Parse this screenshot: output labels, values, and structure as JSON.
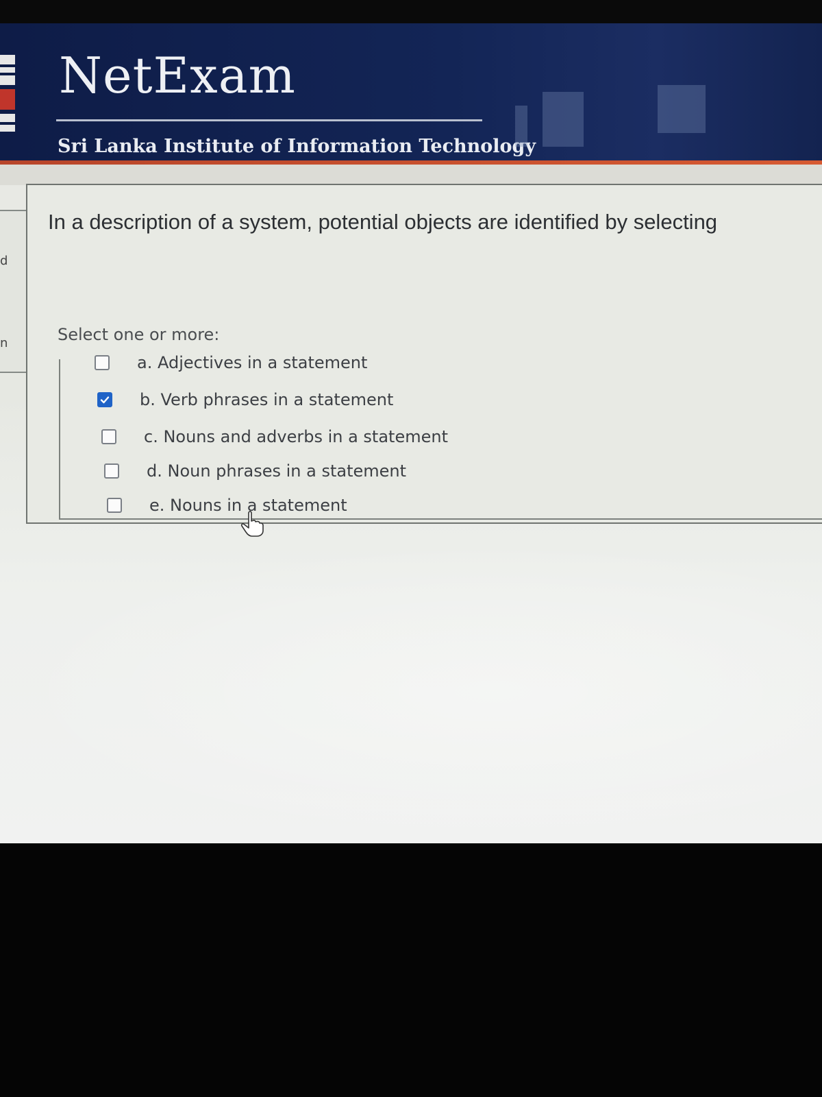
{
  "header": {
    "brand": "NetExam",
    "institution": "Sri Lanka Institute of Information Technology"
  },
  "sidebar_fragments": [
    "d",
    "n"
  ],
  "question": {
    "text": "In a description of a system,  potential objects are identified by selecting",
    "prompt": "Select one or more:",
    "options": [
      {
        "label": "a. Adjectives in a statement",
        "checked": false
      },
      {
        "label": "b. Verb phrases in a statement",
        "checked": true
      },
      {
        "label": "c. Nouns and adverbs in a statement",
        "checked": false
      },
      {
        "label": "d. Noun phrases in a statement",
        "checked": false
      },
      {
        "label": "e. Nouns in a statement",
        "checked": false
      }
    ]
  },
  "colors": {
    "header_bg": "#132556",
    "accent": "#d65a32",
    "checkbox_checked": "#1f63c7"
  },
  "icons": {
    "logo": "sliit-logo-icon",
    "checkmark": "checkmark-icon",
    "cursor": "hand-pointer-icon"
  }
}
